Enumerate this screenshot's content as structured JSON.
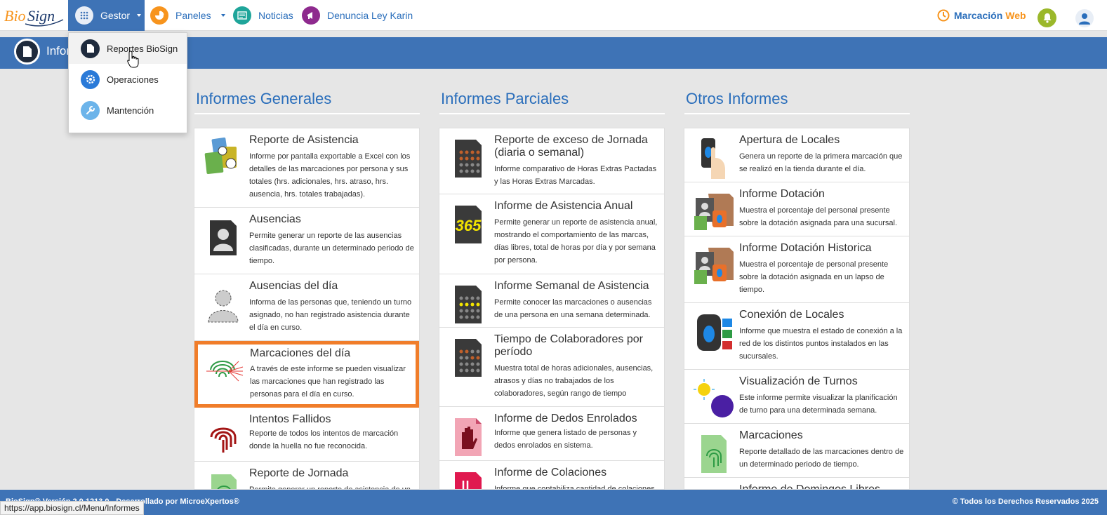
{
  "logo": {
    "text_left": "Bio",
    "text_right": "Sign"
  },
  "nav": {
    "gestor": "Gestor",
    "paneles": "Paneles",
    "noticias": "Noticias",
    "karin": "Denuncia Ley Karin",
    "marcacion": "Marcación",
    "web": "Web"
  },
  "page_title": "Infor",
  "dropdown": [
    {
      "label": "Reportes BioSign"
    },
    {
      "label": "Operaciones"
    },
    {
      "label": "Mantención"
    }
  ],
  "columns": {
    "generales": {
      "title": "Informes Generales",
      "cards": [
        {
          "title": "Reporte de Asistencia",
          "desc": "Informe por pantalla exportable a Excel con los detalles de las marcaciones por persona y sus totales (hrs. adicionales, hrs. atraso, hrs. ausencia, hrs. totales trabajadas)."
        },
        {
          "title": "Ausencias",
          "desc": "Permite generar un reporte de las ausencias clasificadas, durante un determinado periodo de tiempo."
        },
        {
          "title": "Ausencias del día",
          "desc": "Informa de las personas que, teniendo un turno asignado, no han registrado asistencia durante el día en curso."
        },
        {
          "title": "Marcaciones del día",
          "desc": "A través de este informe se pueden visualizar las marcaciones que han registrado las personas para el día en curso."
        },
        {
          "title": "Intentos Fallidos",
          "desc": "Reporte de todos los intentos de marcación donde la huella no fue reconocida."
        },
        {
          "title": "Reporte de Jornada",
          "desc": "Permite generar un reporte de asistencia de un"
        }
      ]
    },
    "parciales": {
      "title": "Informes Parciales",
      "cards": [
        {
          "title": "Reporte de exceso de Jornada (diaria o semanal)",
          "desc": "Informe comparativo de Horas Extras Pactadas y las Horas Extras Marcadas."
        },
        {
          "title": "Informe de Asistencia Anual",
          "desc": "Permite generar un reporte de asistencia anual, mostrando el comportamiento de las marcas, días libres, total de horas por día y por semana por persona."
        },
        {
          "title": "Informe Semanal de Asistencia",
          "desc": "Permite conocer las marcaciones o ausencias de una persona en una semana determinada."
        },
        {
          "title": "Tiempo de Colaboradores por período",
          "desc": "Muestra total de horas adicionales, ausencias, atrasos y días no trabajados de los colaboradores, según rango de tiempo"
        },
        {
          "title": "Informe de Dedos Enrolados",
          "desc": "Informe que genera listado de personas y dedos enrolados en sistema."
        },
        {
          "title": "Informe de Colaciones",
          "desc": "Informe que contabiliza cantidad de colaciones"
        }
      ]
    },
    "otros": {
      "title": "Otros Informes",
      "cards": [
        {
          "title": "Apertura de Locales",
          "desc": "Genera un reporte de la primera marcación que se realizó en la tienda durante el día."
        },
        {
          "title": "Informe Dotación",
          "desc": "Muestra el porcentaje del personal presente sobre la dotación asignada para una sucursal."
        },
        {
          "title": "Informe Dotación Historica",
          "desc": "Muestra el porcentaje de personal presente sobre la dotación asignada en un lapso de tiempo."
        },
        {
          "title": "Conexión de Locales",
          "desc": "Informe que muestra el estado de conexión a la red de los distintos puntos instalados en las sucursales."
        },
        {
          "title": "Visualización de Turnos",
          "desc": "Este informe permite visualizar la planificación de turno para una determinada semana."
        },
        {
          "title": "Marcaciones",
          "desc": "Reporte detallado de las marcaciones dentro de un determinado periodo de tiempo."
        },
        {
          "title": "Informe de Domingos Libres",
          "desc": ""
        }
      ]
    }
  },
  "footer": {
    "left": "BioSign® Versión 2.0.1213.0 - Desarrollado por MicroeXpertos®",
    "right": "© Todos los Derechos Reservados 2025"
  },
  "status_url": "https://app.biosign.cl/Menu/Informes",
  "icon_365_text": "365",
  "colors": {
    "primary": "#3e73b6",
    "accent": "#f7941d",
    "selected_border": "#f07d2a"
  }
}
